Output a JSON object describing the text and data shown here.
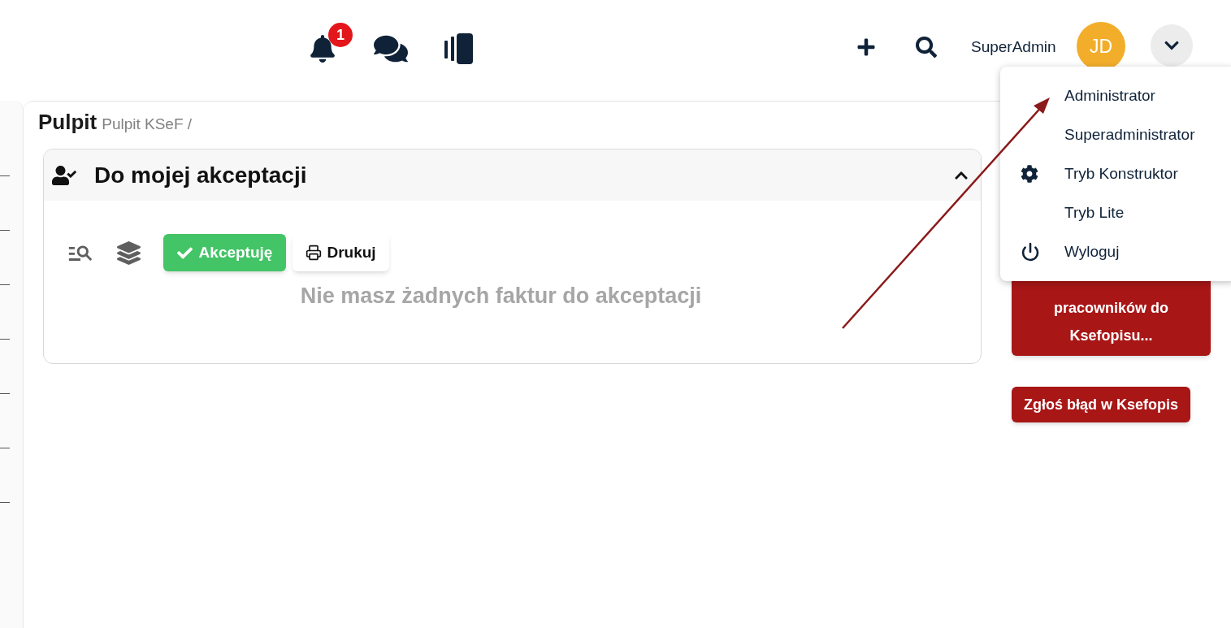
{
  "header": {
    "notification_badge": "1",
    "user_name": "SuperAdmin",
    "avatar_initials": "JD"
  },
  "user_menu": {
    "open": true,
    "items": [
      {
        "label": "Administrator",
        "kind": "plain"
      },
      {
        "label": "Superadministrator",
        "kind": "plain"
      },
      {
        "label": "Tryb Konstruktor",
        "kind": "gear"
      },
      {
        "label": "Tryb Lite",
        "kind": "plain"
      },
      {
        "label": "Wyloguj",
        "kind": "power"
      }
    ]
  },
  "page": {
    "title": "Pulpit",
    "breadcrumb": "Pulpit KSeF /"
  },
  "panel": {
    "title": "Do mojej akceptacji",
    "expanded": true,
    "accept_button": "Akceptuję",
    "print_button": "Drukuj",
    "empty_message": "Nie masz żadnych faktur do akceptacji"
  },
  "side_buttons": [
    "pracowników do Ksefopisu...",
    "Zgłoś błąd w Ksefopis"
  ]
}
